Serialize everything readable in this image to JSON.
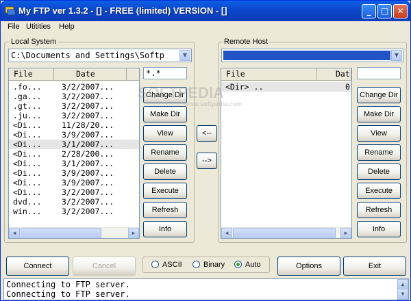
{
  "window": {
    "title": "My FTP ver 1.3.2 - [] - FREE (limited) VERSION - []",
    "controls": [
      "_",
      "□",
      "✕"
    ]
  },
  "menu": [
    "File",
    "Utitities",
    "Help"
  ],
  "local": {
    "legend": "Local System",
    "path": "C:\\Documents and Settings\\Softp",
    "mask": "*.*",
    "columns": [
      "File",
      "Date"
    ],
    "rows": [
      {
        "file": ".fo...",
        "date": "3/2/2007..."
      },
      {
        "file": ".ga...",
        "date": "3/2/2007..."
      },
      {
        "file": ".gt...",
        "date": "3/2/2007..."
      },
      {
        "file": ".ju...",
        "date": "3/2/2007..."
      },
      {
        "file": "<Di...",
        "date": "11/28/20..."
      },
      {
        "file": "<Di...",
        "date": "3/9/2007..."
      },
      {
        "file": "<Di...",
        "date": "3/1/2007..."
      },
      {
        "file": "<Di...",
        "date": "2/28/200..."
      },
      {
        "file": "<Di...",
        "date": "3/1/2007..."
      },
      {
        "file": "<Di...",
        "date": "3/9/2007..."
      },
      {
        "file": "<Di...",
        "date": "3/9/2007..."
      },
      {
        "file": "<Di...",
        "date": "3/2/2007..."
      },
      {
        "file": "dvd...",
        "date": "3/2/2007..."
      },
      {
        "file": "win...",
        "date": "3/2/2007..."
      }
    ],
    "buttons": [
      "Change Dir",
      "Make Dir",
      "View",
      "Rename",
      "Delete",
      "Execute",
      "Refresh",
      "Info"
    ]
  },
  "transfer": {
    "download": "<--",
    "upload": "-->"
  },
  "remote": {
    "legend": "Remote Host",
    "mask": "",
    "columns": [
      "File",
      "Dat"
    ],
    "rows": [
      {
        "file": "<Dir> ..",
        "date": "0"
      }
    ],
    "buttons": [
      "Change Dir",
      "Make Dir",
      "View",
      "Rename",
      "Delete",
      "Execute",
      "Refresh",
      "Info"
    ]
  },
  "bottom": {
    "connect": "Connect",
    "cancel": "Cancel",
    "modes": [
      "ASCII",
      "Binary",
      "Auto"
    ],
    "selected_mode": "Auto",
    "options": "Options",
    "exit": "Exit"
  },
  "log": [
    "Connecting to FTP server.",
    "Connecting to FTP server."
  ],
  "watermark": {
    "big": "SOFTPEDIA",
    "small": "www.softpedia.com"
  }
}
